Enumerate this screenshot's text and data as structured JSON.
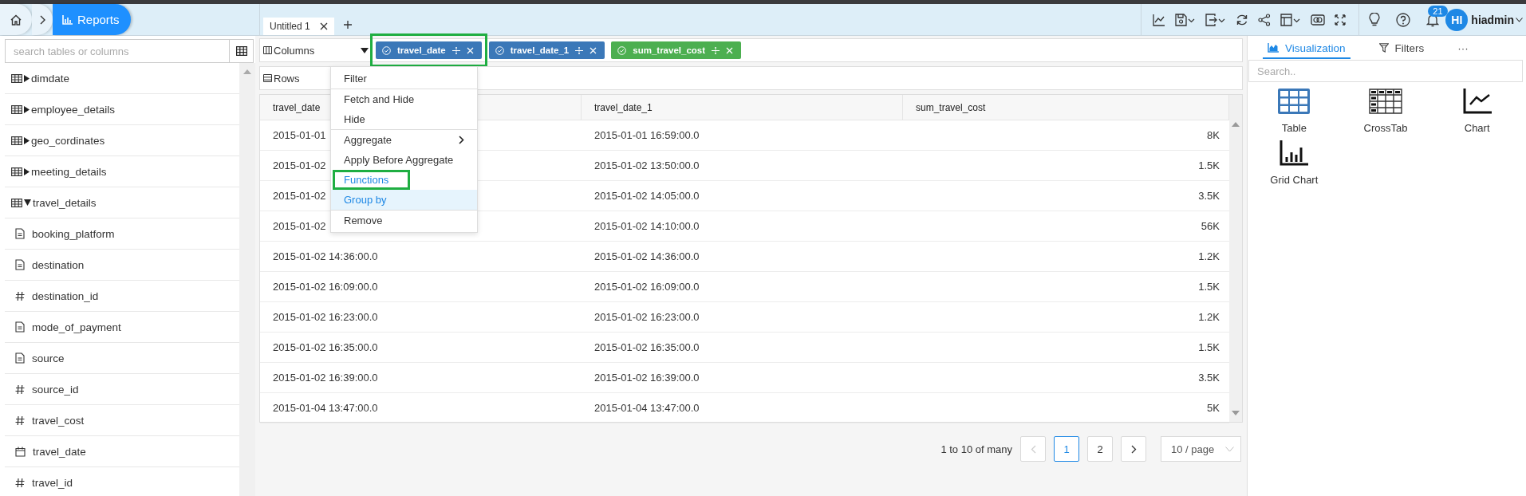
{
  "breadcrumb": {
    "current": "Reports"
  },
  "tabs": [
    {
      "label": "Untitled 1",
      "selected": true
    }
  ],
  "account": {
    "notifications": "21",
    "avatar": "HI",
    "user": "hiadmin"
  },
  "sidebar": {
    "search_placeholder": "search tables or columns",
    "tree": [
      {
        "label": "dimdate",
        "kind": "table",
        "expanded": false
      },
      {
        "label": "employee_details",
        "kind": "table",
        "expanded": false
      },
      {
        "label": "geo_cordinates",
        "kind": "table",
        "expanded": false
      },
      {
        "label": "meeting_details",
        "kind": "table",
        "expanded": false
      },
      {
        "label": "travel_details",
        "kind": "table",
        "expanded": true,
        "children": [
          {
            "label": "booking_platform",
            "kind": "text"
          },
          {
            "label": "destination",
            "kind": "text"
          },
          {
            "label": "destination_id",
            "kind": "number"
          },
          {
            "label": "mode_of_payment",
            "kind": "text"
          },
          {
            "label": "source",
            "kind": "text"
          },
          {
            "label": "source_id",
            "kind": "number"
          },
          {
            "label": "travel_cost",
            "kind": "number"
          },
          {
            "label": "travel_date",
            "kind": "date"
          },
          {
            "label": "travel_id",
            "kind": "number"
          }
        ]
      }
    ]
  },
  "columns_bar": {
    "label": "Columns",
    "chips": [
      {
        "label": "travel_date",
        "color": "#3b78b8",
        "highlighted": true
      },
      {
        "label": "travel_date_1",
        "color": "#3b78b8",
        "highlighted": false
      },
      {
        "label": "sum_travel_cost",
        "color": "#4caf50",
        "highlighted": false
      }
    ]
  },
  "rows_bar": {
    "label": "Rows"
  },
  "context_menu": {
    "items": [
      {
        "label": "Filter",
        "divider_before": false,
        "submenu": false,
        "active": false,
        "hovered": false,
        "highlighted": false
      },
      {
        "label": "Fetch and Hide",
        "divider_before": true,
        "submenu": false,
        "active": false,
        "hovered": false,
        "highlighted": false
      },
      {
        "label": "Hide",
        "divider_before": false,
        "submenu": false,
        "active": false,
        "hovered": false,
        "highlighted": false
      },
      {
        "label": "Aggregate",
        "divider_before": true,
        "submenu": true,
        "active": false,
        "hovered": false,
        "highlighted": false
      },
      {
        "label": "Apply Before Aggregate",
        "divider_before": false,
        "submenu": false,
        "active": false,
        "hovered": false,
        "highlighted": false
      },
      {
        "label": "Functions",
        "divider_before": false,
        "submenu": false,
        "active": true,
        "hovered": false,
        "highlighted": true
      },
      {
        "label": "Group by",
        "divider_before": false,
        "submenu": false,
        "active": true,
        "hovered": true,
        "highlighted": false
      },
      {
        "label": "Remove",
        "divider_before": true,
        "submenu": false,
        "active": false,
        "hovered": false,
        "highlighted": false
      }
    ]
  },
  "table": {
    "columns": [
      "travel_date",
      "travel_date_1",
      "sum_travel_cost"
    ],
    "rows": [
      [
        "2015-01-01",
        "2015-01-01 16:59:00.0",
        "8K"
      ],
      [
        "2015-01-02",
        "2015-01-02 13:50:00.0",
        "1.5K"
      ],
      [
        "2015-01-02",
        "2015-01-02 14:05:00.0",
        "3.5K"
      ],
      [
        "2015-01-02",
        "2015-01-02 14:10:00.0",
        "56K"
      ],
      [
        "2015-01-02 14:36:00.0",
        "2015-01-02 14:36:00.0",
        "1.2K"
      ],
      [
        "2015-01-02 16:09:00.0",
        "2015-01-02 16:09:00.0",
        "1.5K"
      ],
      [
        "2015-01-02 16:23:00.0",
        "2015-01-02 16:23:00.0",
        "1.2K"
      ],
      [
        "2015-01-02 16:35:00.0",
        "2015-01-02 16:35:00.0",
        "1.5K"
      ],
      [
        "2015-01-02 16:39:00.0",
        "2015-01-02 16:39:00.0",
        "3.5K"
      ],
      [
        "2015-01-04 13:47:00.0",
        "2015-01-04 13:47:00.0",
        "5K"
      ]
    ]
  },
  "pagination": {
    "summary": "1 to 10 of many",
    "pages": [
      {
        "label": "1",
        "selected": true
      },
      {
        "label": "2",
        "selected": false
      }
    ],
    "prev_disabled": true,
    "page_size": "10 / page"
  },
  "panel": {
    "tabs": [
      {
        "label": "Visualization",
        "kind": "visualization",
        "selected": true
      },
      {
        "label": "Filters",
        "kind": "filters",
        "selected": false
      },
      {
        "label": "···",
        "kind": "more",
        "selected": false
      }
    ],
    "search_placeholder": "Search..",
    "items": [
      {
        "label": "Table",
        "kind": "table"
      },
      {
        "label": "CrossTab",
        "kind": "crosstab"
      },
      {
        "label": "Chart",
        "kind": "chart"
      },
      {
        "label": "Grid Chart",
        "kind": "gridchart"
      }
    ]
  }
}
